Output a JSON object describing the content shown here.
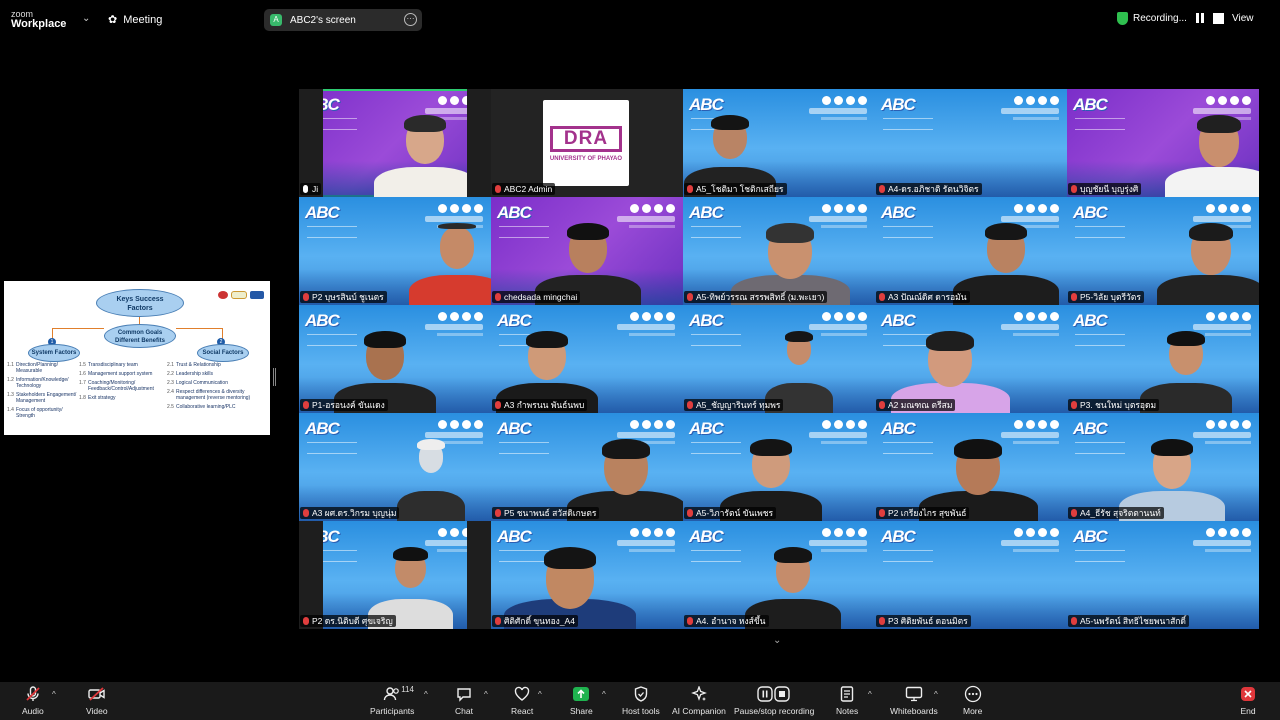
{
  "app": {
    "logo_line1": "zoom",
    "logo_line2": "Workplace",
    "meeting_label": "Meeting"
  },
  "screen_share": {
    "badge": "A",
    "label": "ABC2's screen"
  },
  "recording": {
    "label": "Recording...",
    "status_color": "#2fbf4f"
  },
  "view_label": "View",
  "slide": {
    "title_line1": "Keys Success",
    "title_line2": "Factors",
    "center_line1": "Common Goals",
    "center_line2": "Different Benefits",
    "system_num": "1",
    "system_label": "System Factors",
    "social_num": "2",
    "social_label": "Social Factors",
    "left_items": [
      {
        "n": "1.1",
        "t": "Direction/Planning/ Measurable"
      },
      {
        "n": "1.2",
        "t": "Information/Knowledge/ Technology"
      },
      {
        "n": "1.3",
        "t": "Stakeholders Engagement/ Management"
      },
      {
        "n": "1.4",
        "t": "Focus of opportunity/ Strength"
      }
    ],
    "mid_items": [
      {
        "n": "1.5",
        "t": "Transdisciplinary team"
      },
      {
        "n": "1.6",
        "t": "Management support system"
      },
      {
        "n": "1.7",
        "t": "Coaching/Monitoring/ Feedback/Control/Adjustment"
      },
      {
        "n": "1.8",
        "t": "Exit strategy"
      }
    ],
    "right_items": [
      {
        "n": "2.1",
        "t": "Trust & Relationship"
      },
      {
        "n": "2.2",
        "t": "Leadership skills"
      },
      {
        "n": "2.3",
        "t": "Logical Communication"
      },
      {
        "n": "2.4",
        "t": "Respect differences & diversity management (reverse mentoring)"
      },
      {
        "n": "2.5",
        "t": "Collaborative learning/PLC"
      }
    ]
  },
  "banner_text": "ABC",
  "dra": {
    "logo": "DRA",
    "sub": "UNIVERSITY OF PHAYAO"
  },
  "participants": [
    "Ji",
    "ABC2 Admin",
    "A5_โชติมา โชติกเสถียร",
    "A4-ดร.อภิชาติ รัตนวิจิตร",
    "บุญชัยนี บุญรุ่งศิ",
    "P2 บุษรสินบ์ ชูเนตร",
    "chedsada mingchai",
    "A5-ทิพย์วรรณ สรรพสิทธิ์ (ม.พะเยา)",
    "A3 ปัณณ์ดิศ ดารอมัน",
    "P5-วิลัย บุตรีวัตร",
    "P1-อรอนงค์ ขันแดง",
    "A3 กำพรนน พันธ์นพบ",
    "A5_ชัญญารินทร์ ทุมพร",
    "A2 มณฑณ ตรีสม",
    "P3. ชนใหม่ บุตรอุดม",
    "A3 ผศ.ดร.วิกรม บุญนุ่ม",
    "P5 ชนาพนธ์ สวัสดิเกษตร",
    "A5-วิภารัตน์ ขันเพชร",
    "P2 เกรียงไกร สุขพันธ์",
    "A4_ธีรัช สุจริตตานนท์",
    "P2 ดร.นิติบดี ศุขเจริญ",
    "ศิติศักดิ์ ขุนทอง_A4",
    "A4. อำนาจ หงส์ขึ้น",
    "P3 ศิติยพันธ์ ดอนมิตร",
    "A5-นพรัตน์ สิทธิไชยพนาสักดิ์"
  ],
  "toolbar": {
    "audio": "Audio",
    "video": "Video",
    "participants": "Participants",
    "participants_count": "114",
    "chat": "Chat",
    "react": "React",
    "share": "Share",
    "host_tools": "Host tools",
    "ai_companion": "AI Companion",
    "pause_recording": "Pause/stop recording",
    "notes": "Notes",
    "whiteboards": "Whiteboards",
    "more": "More",
    "end": "End"
  },
  "colors": {
    "share_green": "#1fb34f",
    "end_red": "#e0373b",
    "active_speaker": "#2ecb71"
  }
}
